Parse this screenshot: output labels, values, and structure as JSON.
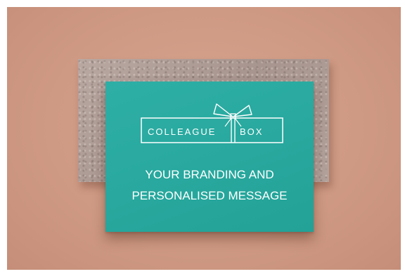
{
  "card": {
    "brand_left": "COLLEAGUE",
    "brand_right": "BOX",
    "message_line1": "YOUR BRANDING AND",
    "message_line2": "PERSONALISED MESSAGE"
  },
  "colors": {
    "background": "#d0a08b",
    "card": "#2aa89e",
    "stone": "#b1a09a",
    "text": "#ffffff"
  },
  "icons": [
    "ribbon-bow-icon"
  ]
}
